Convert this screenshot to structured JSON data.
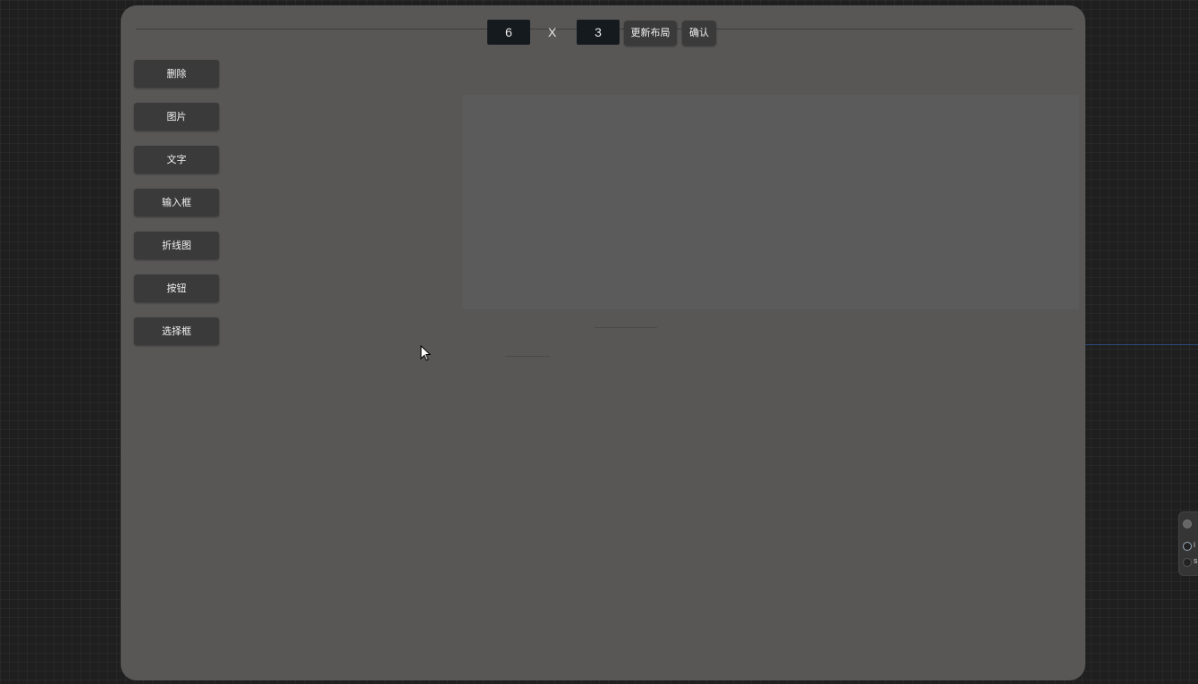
{
  "toolbar": {
    "rows_value": "6",
    "separator": "X",
    "cols_value": "3",
    "update_layout_label": "更新布局",
    "confirm_label": "确认"
  },
  "sidebar": {
    "items": [
      {
        "label": "删除",
        "name": "delete-button"
      },
      {
        "label": "图片",
        "name": "image-button"
      },
      {
        "label": "文字",
        "name": "text-button"
      },
      {
        "label": "输入框",
        "name": "input-box-button"
      },
      {
        "label": "折线图",
        "name": "line-chart-button"
      },
      {
        "label": "按钮",
        "name": "button-widget-button"
      },
      {
        "label": "选择框",
        "name": "select-box-button"
      }
    ]
  },
  "side_node": {
    "labels": [
      "i",
      "s"
    ]
  },
  "colors": {
    "panel": "#585756",
    "button": "#3a3a3a",
    "input": "#151a1f",
    "canvas": "#1f1f1f"
  }
}
